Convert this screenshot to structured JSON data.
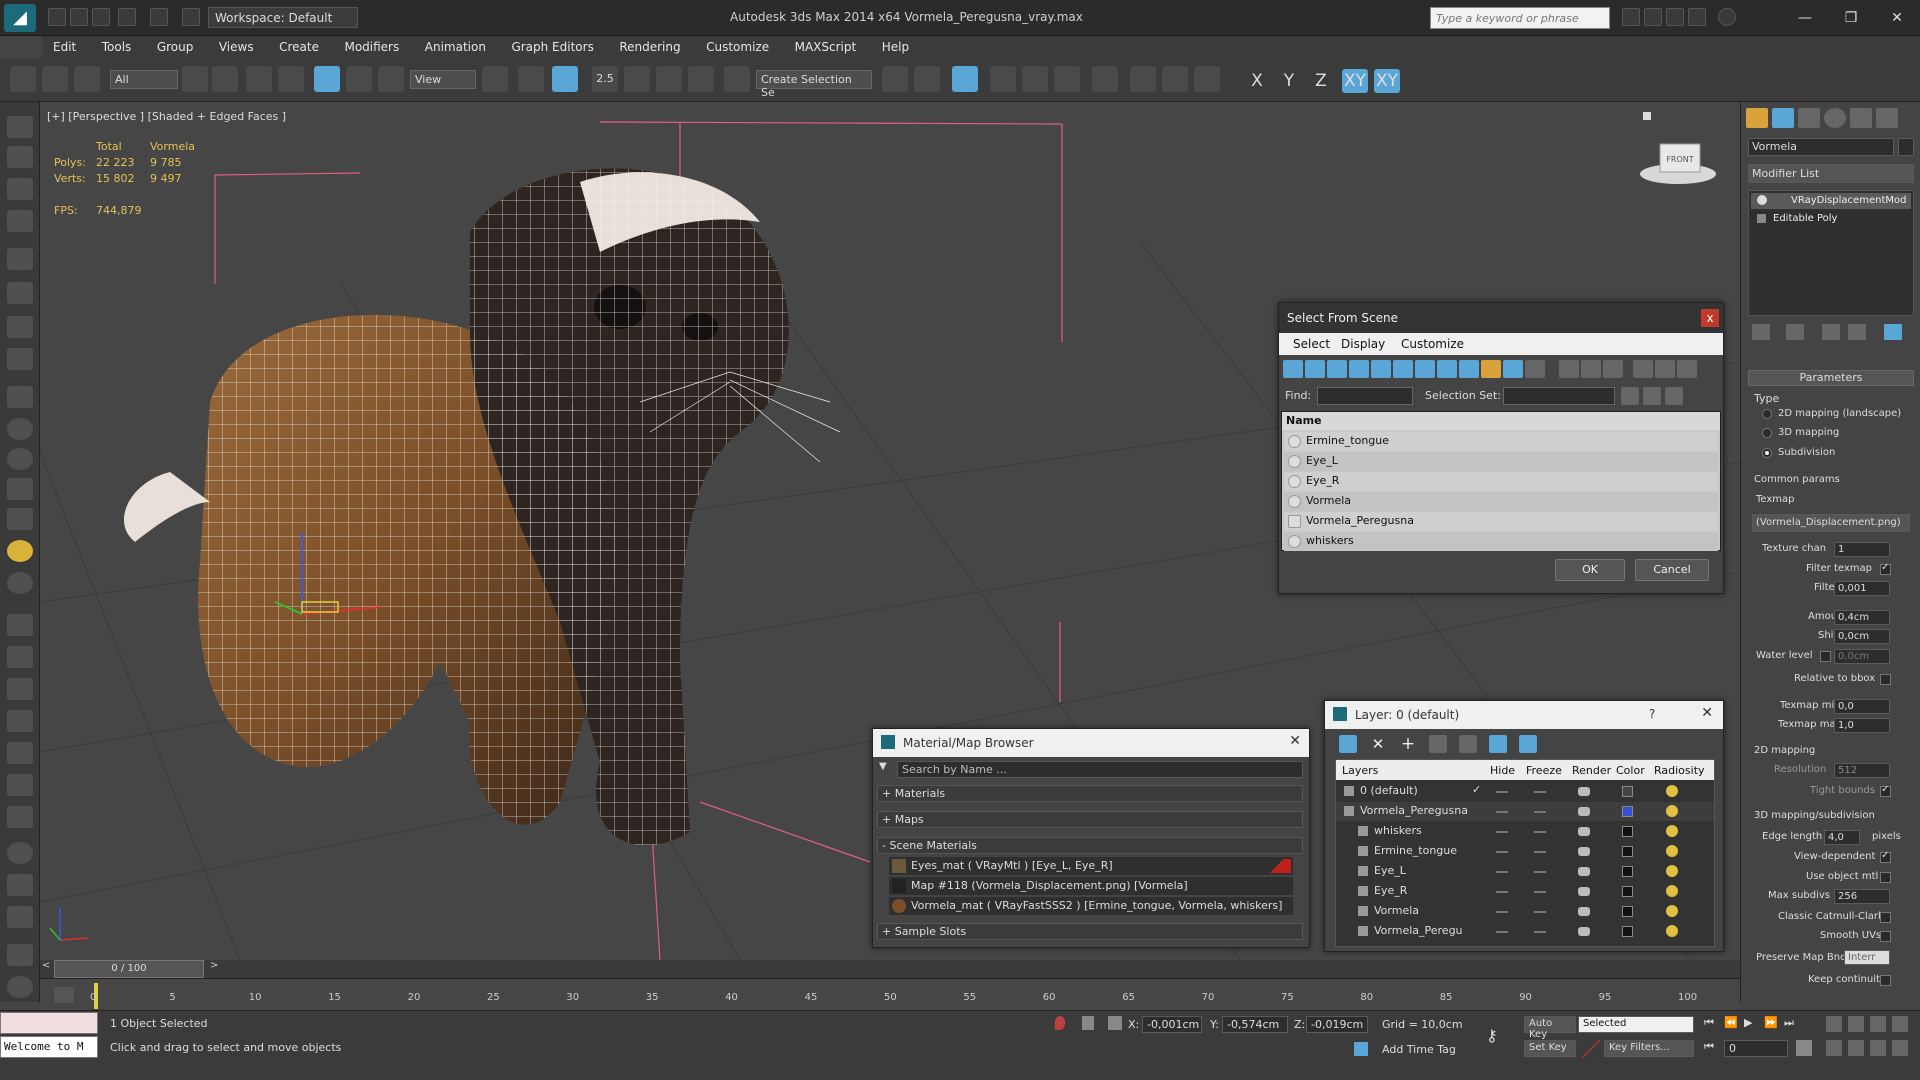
{
  "titlebar": {
    "workspace": "Workspace: Default",
    "app_title": "Autodesk 3ds Max  2014 x64     Vormela_Peregusna_vray.max",
    "search_placeholder": "Type a keyword or phrase"
  },
  "menu": [
    "Edit",
    "Tools",
    "Group",
    "Views",
    "Create",
    "Modifiers",
    "Animation",
    "Graph Editors",
    "Rendering",
    "Customize",
    "MAXScript",
    "Help"
  ],
  "toolbar": {
    "filter_select": "All",
    "ref_coord": "View",
    "snap_angle": "2.5",
    "selection_set": "Create Selection Se",
    "axes": [
      "X",
      "Y",
      "Z",
      "XY",
      "XY"
    ]
  },
  "viewport": {
    "label": "[+] [Perspective ] [Shaded + Edged Faces ]",
    "stats": {
      "header_total": "Total",
      "header_obj": "Vormela",
      "polys_label": "Polys:",
      "polys_total": "22 223",
      "polys_obj": "9 785",
      "verts_label": "Verts:",
      "verts_total": "15 802",
      "verts_obj": "9 497",
      "fps_label": "FPS:",
      "fps": "744,879"
    },
    "viewcube_label": "FRONT"
  },
  "select_dialog": {
    "title": "Select From Scene",
    "close": "x",
    "menu": [
      "Select",
      "Display",
      "Customize"
    ],
    "find_label": "Find:",
    "selection_set_label": "Selection Set:",
    "column_name": "Name",
    "items": [
      "Ermine_tongue",
      "Eye_L",
      "Eye_R",
      "Vormela",
      "Vormela_Peregusna",
      "whiskers"
    ],
    "ok": "OK",
    "cancel": "Cancel"
  },
  "material_browser": {
    "title": "Material/Map Browser",
    "search_placeholder": "Search by Name ...",
    "sections": [
      "+ Materials",
      "+ Maps",
      "- Scene Materials"
    ],
    "scene_materials": [
      "Eyes_mat  ( VRayMtl ) [Eye_L, Eye_R]",
      "Map #118 (Vormela_Displacement.png) [Vormela]",
      "Vormela_mat  ( VRayFastSSS2 ) [Ermine_tongue, Vormela, whiskers]"
    ],
    "sample_slots": "+ Sample Slots"
  },
  "layer_dialog": {
    "title": "Layer: 0 (default)",
    "help": "?",
    "close": "✕",
    "columns": [
      "Layers",
      "Hide",
      "Freeze",
      "Render",
      "Color",
      "Radiosity"
    ],
    "rows": [
      {
        "name": "0 (default)",
        "color": "#444444"
      },
      {
        "name": "Vormela_Peregusna",
        "color": "#3a4fd0"
      },
      {
        "name": "whiskers",
        "color": "#111111"
      },
      {
        "name": "Ermine_tongue",
        "color": "#111111"
      },
      {
        "name": "Eye_L",
        "color": "#111111"
      },
      {
        "name": "Eye_R",
        "color": "#111111"
      },
      {
        "name": "Vormela",
        "color": "#111111"
      },
      {
        "name": "Vormela_Peregu",
        "color": "#111111"
      }
    ]
  },
  "command_panel": {
    "object_name": "Vormela",
    "modifier_list": "Modifier List",
    "stack": [
      "VRayDisplacementMod",
      "Editable Poly"
    ],
    "parameters": "Parameters",
    "type_label": "Type",
    "type_options": [
      "2D mapping (landscape)",
      "3D mapping",
      "Subdivision"
    ],
    "common_params": "Common params",
    "texmap_label": "Texmap",
    "texmap_value": "(Vormela_Displacement.png)",
    "texture_chan_label": "Texture chan",
    "texture_chan": "1",
    "filter_texmap": "Filter texmap",
    "filter_blur_label": "Filter blur",
    "filter_blur": "0,001",
    "amount_label": "Amount",
    "amount": "0,4cm",
    "shift_label": "Shift",
    "shift": "0,0cm",
    "water_level_label": "Water level",
    "water_level": "0,0cm",
    "relative_to_bbox": "Relative to bbox",
    "texmap_min_label": "Texmap min",
    "texmap_min": "0,0",
    "texmap_max_label": "Texmap max",
    "texmap_max": "1,0",
    "mapping_2d": "2D mapping",
    "resolution_label": "Resolution",
    "resolution": "512",
    "tight_bounds": "Tight bounds",
    "mapping_3d": "3D mapping/subdivision",
    "edge_length_label": "Edge length",
    "edge_length": "4,0",
    "pixels": "pixels",
    "view_dependent": "View-dependent",
    "use_object_mtl": "Use object mtl",
    "max_subdivs_label": "Max subdivs",
    "max_subdivs": "256",
    "classic_catmull": "Classic Catmull-Clark",
    "smooth_uvs": "Smooth UVs",
    "preserve_map_bnd": "Preserve Map Bnd",
    "preserve_map_value": "Interr",
    "keep_continuity": "Keep continuity"
  },
  "timeline": {
    "frame_range": "0 / 100",
    "ticks": [
      "0",
      "5",
      "10",
      "15",
      "20",
      "25",
      "30",
      "35",
      "40",
      "45",
      "50",
      "55",
      "60",
      "65",
      "70",
      "75",
      "80",
      "85",
      "90",
      "95",
      "100"
    ]
  },
  "status": {
    "maxscript": "Welcome to M",
    "selected": "1 Object Selected",
    "prompt": "Click and drag to select and move objects",
    "x_label": "X:",
    "x": "-0,001cm",
    "y_label": "Y:",
    "y": "-0,574cm",
    "z_label": "Z:",
    "z": "-0,019cm",
    "grid": "Grid = 10,0cm",
    "add_time_tag": "Add Time Tag",
    "auto_key": "Auto Key",
    "set_key": "Set Key",
    "key_select": "Selected",
    "key_filters": "Key Filters...",
    "frame": "0"
  }
}
